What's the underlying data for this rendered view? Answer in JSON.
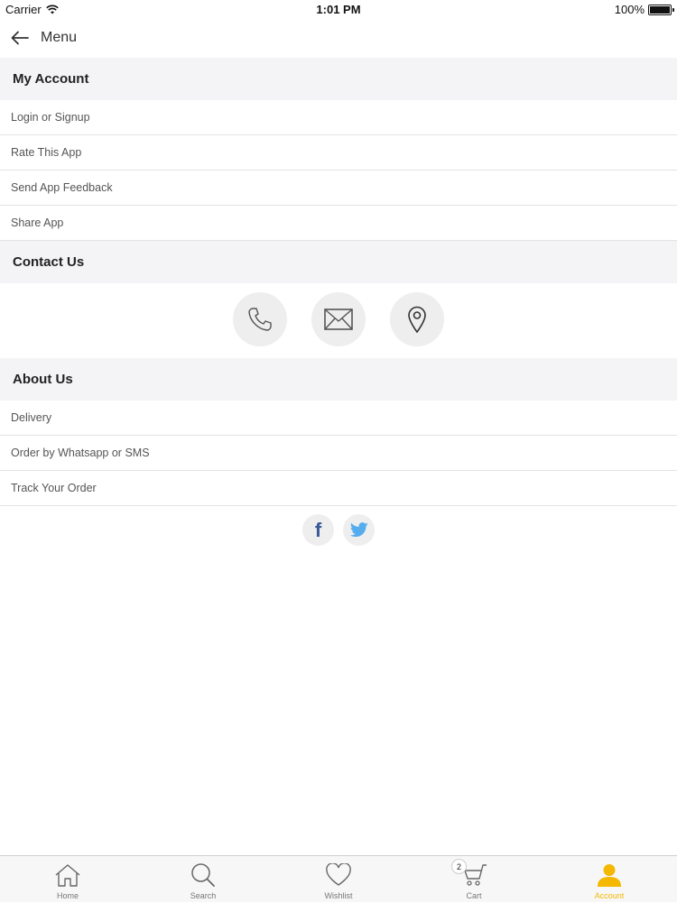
{
  "status_bar": {
    "carrier": "Carrier",
    "time": "1:01 PM",
    "battery": "100%"
  },
  "nav": {
    "title": "Menu"
  },
  "my_account": {
    "header": "My Account",
    "items": [
      "Login or Signup",
      "Rate This App",
      "Send App Feedback",
      "Share App"
    ]
  },
  "contact": {
    "header": "Contact Us",
    "buttons": [
      "phone-icon",
      "mail-icon",
      "location-pin-icon"
    ]
  },
  "about": {
    "header": "About Us",
    "items": [
      "Delivery",
      "Order by Whatsapp or SMS",
      "Track Your Order"
    ]
  },
  "social": {
    "icons": [
      "facebook-icon",
      "twitter-icon"
    ],
    "facebook_glyph": "f"
  },
  "tabs": {
    "home": "Home",
    "search": "Search",
    "wishlist": "Wishlist",
    "cart": "Cart",
    "cart_count": "2",
    "account": "Account"
  },
  "colors": {
    "accent": "#f5b800",
    "section_bg": "#f4f3f6",
    "facebook": "#3b5998",
    "twitter": "#55acee"
  }
}
